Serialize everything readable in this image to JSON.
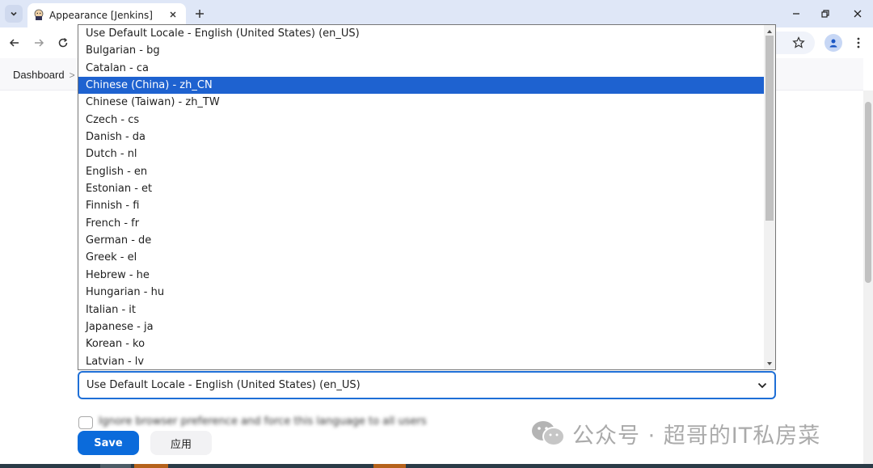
{
  "browser": {
    "tab": {
      "title": "Appearance [Jenkins]"
    }
  },
  "breadcrumb": {
    "root": "Dashboard",
    "separator": ">"
  },
  "language_select": {
    "selected_value": "Use Default Locale - English (United States) (en_US)",
    "highlighted_index": 3,
    "options": [
      "Use Default Locale - English (United States) (en_US)",
      "Bulgarian - bg",
      "Catalan - ca",
      "Chinese (China) - zh_CN",
      "Chinese (Taiwan) - zh_TW",
      "Czech - cs",
      "Danish - da",
      "Dutch - nl",
      "English - en",
      "Estonian - et",
      "Finnish - fi",
      "French - fr",
      "German - de",
      "Greek - el",
      "Hebrew - he",
      "Hungarian - hu",
      "Italian - it",
      "Japanese - ja",
      "Korean - ko",
      "Latvian - lv"
    ]
  },
  "buttons": {
    "save": "Save",
    "apply": "应用"
  },
  "watermark": {
    "text": "公众号 · 超哥的IT私房菜"
  },
  "colors": {
    "accent": "#0b6bdb",
    "highlight": "#1e62d0",
    "tabbar": "#dfe7f7"
  }
}
